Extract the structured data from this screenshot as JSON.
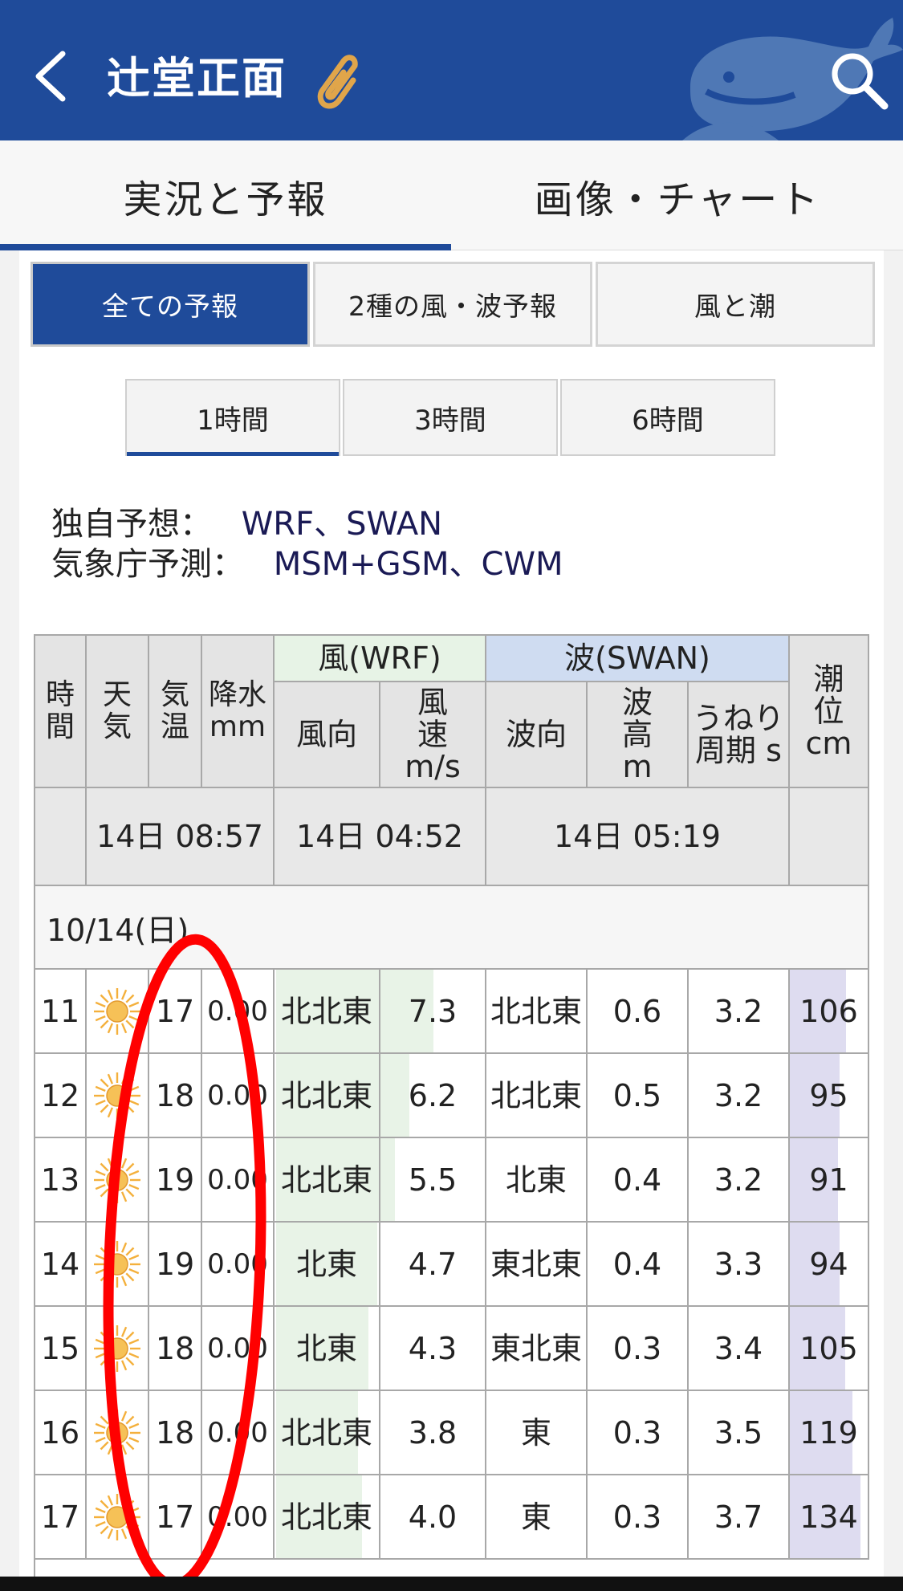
{
  "header": {
    "title": "辻堂正面",
    "back_icon": "chevron-left-icon",
    "clip_icon": "paperclip-icon",
    "search_icon": "search-icon",
    "logo_icon": "whale-icon",
    "color": "#1f4b9a"
  },
  "main_tabs": [
    {
      "label": "実況と予報",
      "active": true
    },
    {
      "label": "画像・チャート",
      "active": false
    }
  ],
  "sub_tabs": [
    {
      "label": "全ての予報",
      "active": true
    },
    {
      "label": "2種の風・波予報",
      "active": false
    },
    {
      "label": "風と潮",
      "active": false
    }
  ],
  "interval_tabs": [
    {
      "label": "1時間",
      "active": true
    },
    {
      "label": "3時間",
      "active": false
    },
    {
      "label": "6時間",
      "active": false
    }
  ],
  "models": {
    "own_label": "独自予想：",
    "own_value": "WRF、SWAN",
    "jma_label": "気象庁予測：",
    "jma_value": "MSM+GSM、CWM"
  },
  "table": {
    "headers": {
      "time": "時間",
      "weather": "天気",
      "temp": "気温",
      "precip": "降水mm",
      "wind_group": "風(WRF)",
      "wind_dir": "風向",
      "wind_speed": "風速m/s",
      "wave_group": "波(SWAN)",
      "wave_dir": "波向",
      "wave_height": "波高m",
      "swell_period": "うねり周期 s",
      "tide": "潮位cm"
    },
    "updated": {
      "weather": "14日 08:57",
      "wind": "14日 04:52",
      "wave": "14日 05:19"
    },
    "date_label": "10/14(日)",
    "weather_icon": "sun-icon",
    "rows": [
      {
        "hour": "11",
        "temp": "17",
        "precip": "0.00",
        "wind_dir": "北北東",
        "wind_speed": "7.3",
        "wave_dir": "北北東",
        "wave_height": "0.6",
        "period": "3.2",
        "tide": "106"
      },
      {
        "hour": "12",
        "temp": "18",
        "precip": "0.00",
        "wind_dir": "北北東",
        "wind_speed": "6.2",
        "wave_dir": "北北東",
        "wave_height": "0.5",
        "period": "3.2",
        "tide": "95"
      },
      {
        "hour": "13",
        "temp": "19",
        "precip": "0.00",
        "wind_dir": "北北東",
        "wind_speed": "5.5",
        "wave_dir": "北東",
        "wave_height": "0.4",
        "period": "3.2",
        "tide": "91"
      },
      {
        "hour": "14",
        "temp": "19",
        "precip": "0.00",
        "wind_dir": "北東",
        "wind_speed": "4.7",
        "wave_dir": "東北東",
        "wave_height": "0.4",
        "period": "3.3",
        "tide": "94"
      },
      {
        "hour": "15",
        "temp": "18",
        "precip": "0.00",
        "wind_dir": "北東",
        "wind_speed": "4.3",
        "wave_dir": "東北東",
        "wave_height": "0.3",
        "period": "3.4",
        "tide": "105"
      },
      {
        "hour": "16",
        "temp": "18",
        "precip": "0.00",
        "wind_dir": "北北東",
        "wind_speed": "3.8",
        "wave_dir": "東",
        "wave_height": "0.3",
        "period": "3.5",
        "tide": "119"
      },
      {
        "hour": "17",
        "temp": "17",
        "precip": "0.00",
        "wind_dir": "北北東",
        "wind_speed": "4.0",
        "wave_dir": "東",
        "wave_height": "0.3",
        "period": "3.7",
        "tide": "134"
      }
    ]
  },
  "colors": {
    "brand": "#1f4b9a",
    "wind_bar": "#e8f3e7",
    "tide_bar": "#dedcf0",
    "annotation": "#ff0000",
    "sun": "#f4b03c"
  }
}
